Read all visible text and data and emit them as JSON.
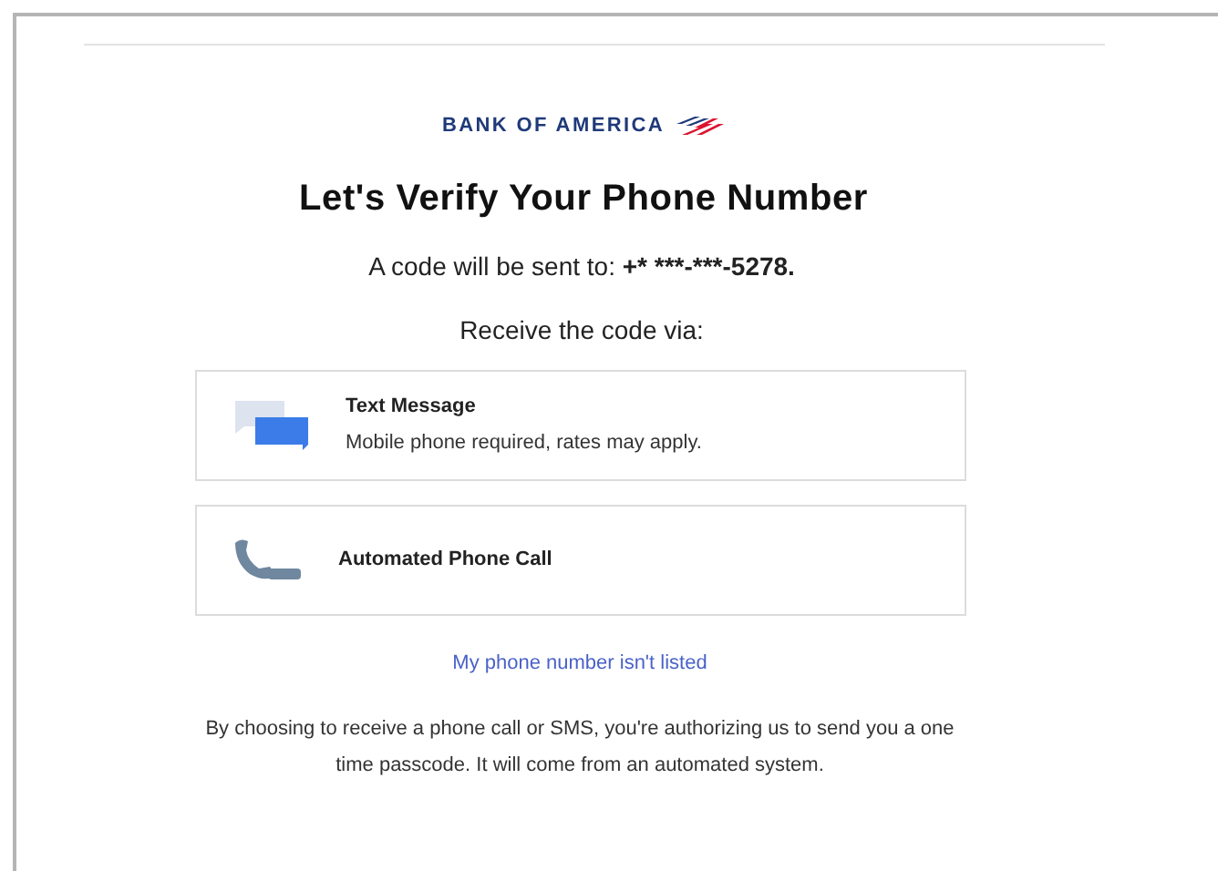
{
  "logo": {
    "text": "BANK OF AMERICA"
  },
  "heading": "Let's Verify Your Phone Number",
  "code_notice": {
    "label": "A code will be sent to:",
    "phone": "+* ***-***-5278."
  },
  "prompt": "Receive the code via:",
  "options": [
    {
      "kind": "sms",
      "title": "Text Message",
      "description": "Mobile phone required, rates may apply."
    },
    {
      "kind": "call",
      "title": "Automated Phone Call"
    }
  ],
  "link": "My phone number isn't listed",
  "disclaimer": "By choosing to receive a phone call or SMS, you're authorizing us to send you a one time passcode. It will come from an automated system."
}
